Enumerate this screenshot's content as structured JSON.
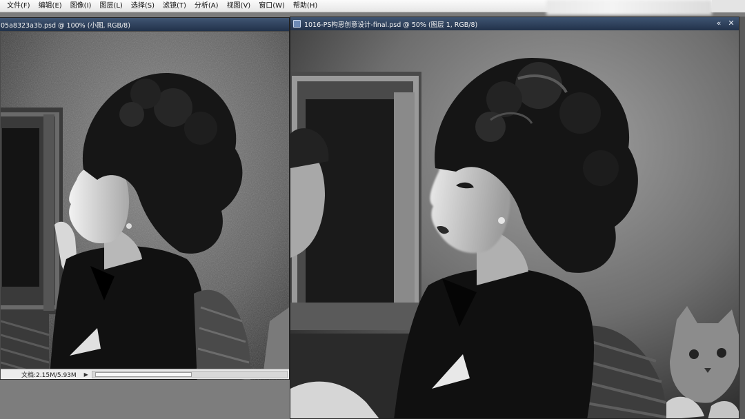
{
  "menubar": {
    "items": [
      "文件(F)",
      "编辑(E)",
      "图像(I)",
      "图层(L)",
      "选择(S)",
      "滤镜(T)",
      "分析(A)",
      "视图(V)",
      "窗口(W)",
      "帮助(H)"
    ]
  },
  "left_doc": {
    "title": "05a8323a3b.psd @ 100% (小图, RGB/8)",
    "status_text": "文档:2.15M/5.93M",
    "status_prev": "◀",
    "status_next": "▶"
  },
  "right_doc": {
    "title": "1016-PS构思创意设计-final.psd @ 50% (图层 1, RGB/8)",
    "collapse_glyph": "«",
    "close_glyph": "✕"
  },
  "colors": {
    "title_bar": "#2e405c",
    "menu_bg": "#f2f2f2",
    "status_bg": "#ececec",
    "workspace": "#7d7d7d"
  },
  "icons": [
    "document-icon",
    "close-icon",
    "collapse-icon",
    "scroll-left-icon",
    "scroll-right-icon"
  ]
}
